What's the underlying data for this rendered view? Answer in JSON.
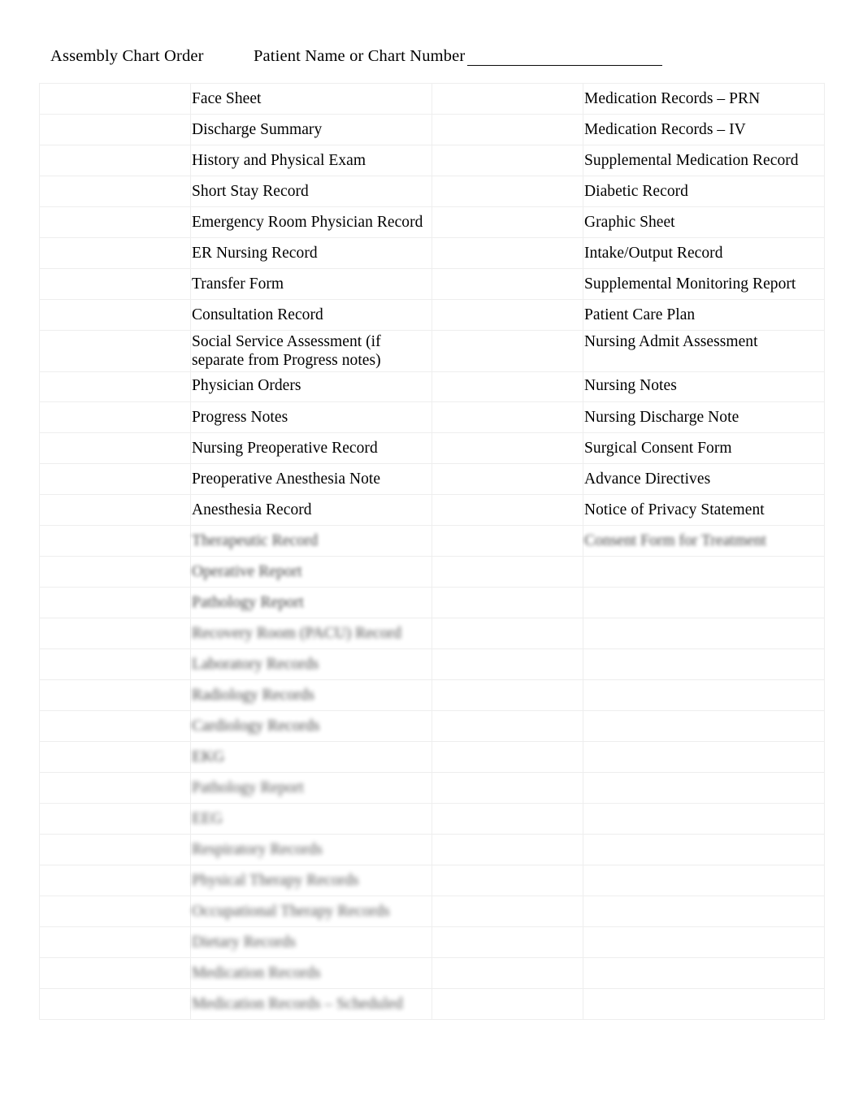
{
  "header": {
    "title": "Assembly Chart Order",
    "patient_label": "Patient  Name or Chart  Number",
    "blank_line": ""
  },
  "table": {
    "rows": [
      {
        "left": "Face Sheet",
        "right": "Medication Records – PRN",
        "left_blur": 0,
        "right_blur": 0
      },
      {
        "left": "Discharge Summary",
        "right": "Medication Records – IV",
        "left_blur": 0,
        "right_blur": 0
      },
      {
        "left": "History and Physical Exam",
        "right": "Supplemental Medication Record",
        "left_blur": 0,
        "right_blur": 0
      },
      {
        "left": "Short Stay Record",
        "right": "Diabetic Record",
        "left_blur": 0,
        "right_blur": 0
      },
      {
        "left": "Emergency Room Physician Record",
        "right": "Graphic Sheet",
        "left_blur": 0,
        "right_blur": 0
      },
      {
        "left": "ER Nursing Record",
        "right": "Intake/Output Record",
        "left_blur": 0,
        "right_blur": 0
      },
      {
        "left": "Transfer Form",
        "right": "Supplemental Monitoring Report",
        "left_blur": 0,
        "right_blur": 0
      },
      {
        "left": "Consultation Record",
        "right": "Patient Care Plan",
        "left_blur": 0,
        "right_blur": 0
      },
      {
        "left": "Social Service Assessment (if separate from Progress notes)",
        "right": "Nursing Admit Assessment",
        "left_blur": 0,
        "right_blur": 0
      },
      {
        "left": "Physician Orders",
        "right": "Nursing Notes",
        "left_blur": 0,
        "right_blur": 0
      },
      {
        "left": "Progress Notes",
        "right": "Nursing Discharge Note",
        "left_blur": 0,
        "right_blur": 0
      },
      {
        "left": "Nursing Preoperative Record",
        "right": "Surgical Consent Form",
        "left_blur": 0,
        "right_blur": 0
      },
      {
        "left": "Preoperative Anesthesia Note",
        "right": "Advance Directives",
        "left_blur": 0,
        "right_blur": 0
      },
      {
        "left": "Anesthesia Record",
        "right": "Notice of Privacy Statement",
        "left_blur": 0,
        "right_blur": 0
      },
      {
        "left": "Therapeutic Record",
        "right": "Consent Form for Treatment",
        "left_blur": 3,
        "right_blur": 3
      },
      {
        "left": "Operative Report",
        "right": "",
        "left_blur": 3,
        "right_blur": 0
      },
      {
        "left": "Pathology Report",
        "right": "",
        "left_blur": 3,
        "right_blur": 0
      },
      {
        "left": "Recovery Room (PACU) Record",
        "right": "",
        "left_blur": 4,
        "right_blur": 0
      },
      {
        "left": "Laboratory Records",
        "right": "",
        "left_blur": 4,
        "right_blur": 0
      },
      {
        "left": "Radiology Records",
        "right": "",
        "left_blur": 4,
        "right_blur": 0
      },
      {
        "left": "Cardiology Records",
        "right": "",
        "left_blur": 4,
        "right_blur": 0
      },
      {
        "left": "EKG",
        "right": "",
        "left_blur": 4,
        "right_blur": 0
      },
      {
        "left": "Pathology Report",
        "right": "",
        "left_blur": 5,
        "right_blur": 0
      },
      {
        "left": "EEG",
        "right": "",
        "left_blur": 5,
        "right_blur": 0
      },
      {
        "left": "Respiratory Records",
        "right": "",
        "left_blur": 5,
        "right_blur": 0
      },
      {
        "left": "Physical Therapy Records",
        "right": "",
        "left_blur": 5,
        "right_blur": 0
      },
      {
        "left": "Occupational Therapy Records",
        "right": "",
        "left_blur": 5,
        "right_blur": 0
      },
      {
        "left": "Dietary Records",
        "right": "",
        "left_blur": 5,
        "right_blur": 0
      },
      {
        "left": "Medication Records",
        "right": "",
        "left_blur": 5,
        "right_blur": 0
      },
      {
        "left": "Medication Records – Scheduled",
        "right": "",
        "left_blur": 5,
        "right_blur": 0
      }
    ]
  }
}
